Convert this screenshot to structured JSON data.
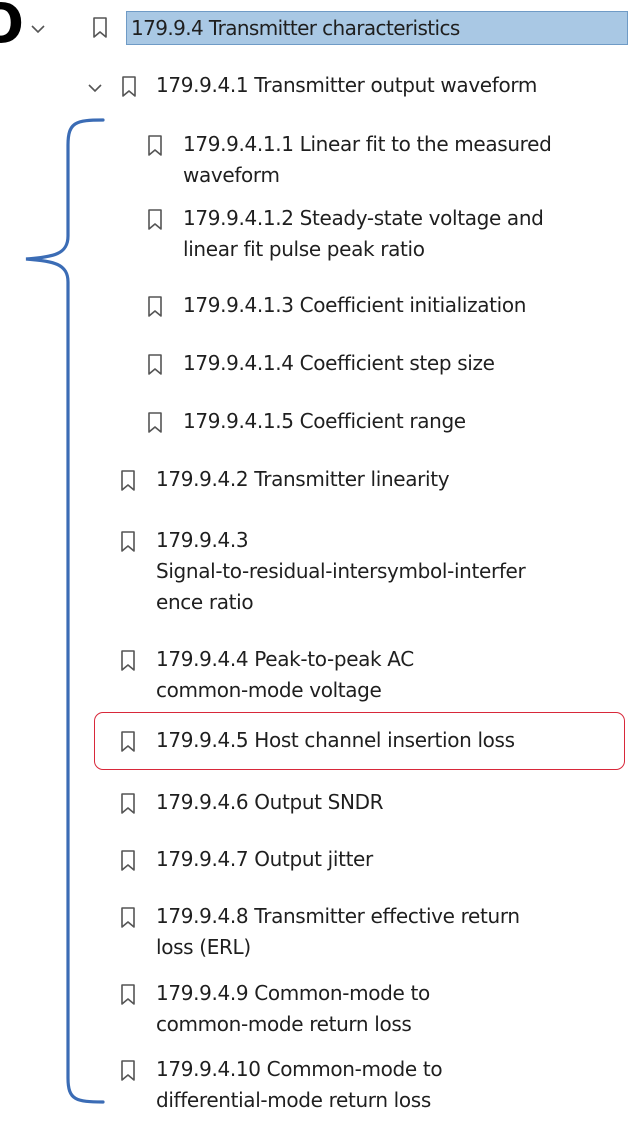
{
  "edge_glyph": "O",
  "selected_item": {
    "label": "179.9.4 Transmitter characteristics"
  },
  "items": [
    {
      "lines": [
        "179.9.4.1 Transmitter output waveform"
      ],
      "expanded": true
    },
    {
      "lines": [
        "179.9.4.1.1 Linear fit to the measured",
        "waveform"
      ]
    },
    {
      "lines": [
        "179.9.4.1.2 Steady-state voltage and",
        "linear fit pulse peak ratio"
      ]
    },
    {
      "lines": [
        "179.9.4.1.3 Coefficient initialization"
      ]
    },
    {
      "lines": [
        "179.9.4.1.4 Coefficient step size"
      ]
    },
    {
      "lines": [
        "179.9.4.1.5 Coefficient range"
      ]
    },
    {
      "lines": [
        "179.9.4.2 Transmitter linearity"
      ]
    },
    {
      "lines": [
        "179.9.4.3",
        "Signal-to-residual-intersymbol-interfer",
        "ence ratio"
      ]
    },
    {
      "lines": [
        "179.9.4.4 Peak-to-peak AC",
        "common-mode voltage"
      ]
    },
    {
      "lines": [
        "179.9.4.5 Host channel insertion loss"
      ],
      "highlighted": true
    },
    {
      "lines": [
        "179.9.4.6 Output SNDR"
      ]
    },
    {
      "lines": [
        "179.9.4.7 Output jitter"
      ]
    },
    {
      "lines": [
        "179.9.4.8 Transmitter effective return",
        "loss (ERL)"
      ]
    },
    {
      "lines": [
        "179.9.4.9 Common-mode to",
        "common-mode return loss"
      ]
    },
    {
      "lines": [
        "179.9.4.10 Common-mode to",
        "differential-mode return loss"
      ]
    }
  ],
  "colors": {
    "selection_fill": "#a9c8e4",
    "highlight_border": "#d8283a",
    "brace": "#3b6cb5",
    "icon": "#555555"
  },
  "icons": {
    "expand": "chevron-down-icon",
    "bookmark": "bookmark-icon"
  }
}
